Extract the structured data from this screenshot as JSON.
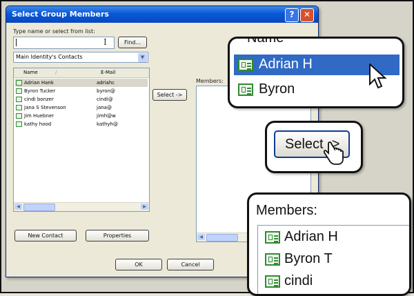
{
  "dialog": {
    "title": "Select Group Members",
    "help_label": "?",
    "close_label": "✕",
    "type_name_label": "Type name or select from list:",
    "search_value": "",
    "find_label": "Find...",
    "addressbook_selected": "Main Identity's Contacts",
    "columns": [
      "Name",
      "E-Mail"
    ],
    "sort_indicator": "/",
    "contacts": [
      {
        "name": "Adrian Hank",
        "email": "adriahc"
      },
      {
        "name": "Byron Tucker",
        "email": "byron@"
      },
      {
        "name": "cindi bonzer",
        "email": "cindi@"
      },
      {
        "name": "Jana S Stevenson",
        "email": "jana@"
      },
      {
        "name": "Jim Huebner",
        "email": "jimh@w"
      },
      {
        "name": "kathy hood",
        "email": "kathyh@"
      }
    ],
    "select_button": "Select ->",
    "members_label": "Members:",
    "new_contact_button": "New Contact",
    "properties_button": "Properties",
    "ok_button": "OK",
    "cancel_button": "Cancel"
  },
  "callouts": {
    "name_header": "Name",
    "name_items": [
      "Adrian H",
      "Byron"
    ],
    "select_button": "Select ->",
    "members_label": "Members:",
    "members_items": [
      "Adrian H",
      "Byron T",
      "cindi"
    ]
  },
  "colors": {
    "titlebar": "#0a58d8",
    "highlight": "#316ac5",
    "dialog_bg": "#ece9d8",
    "icon_green": "#2f8a2f"
  }
}
